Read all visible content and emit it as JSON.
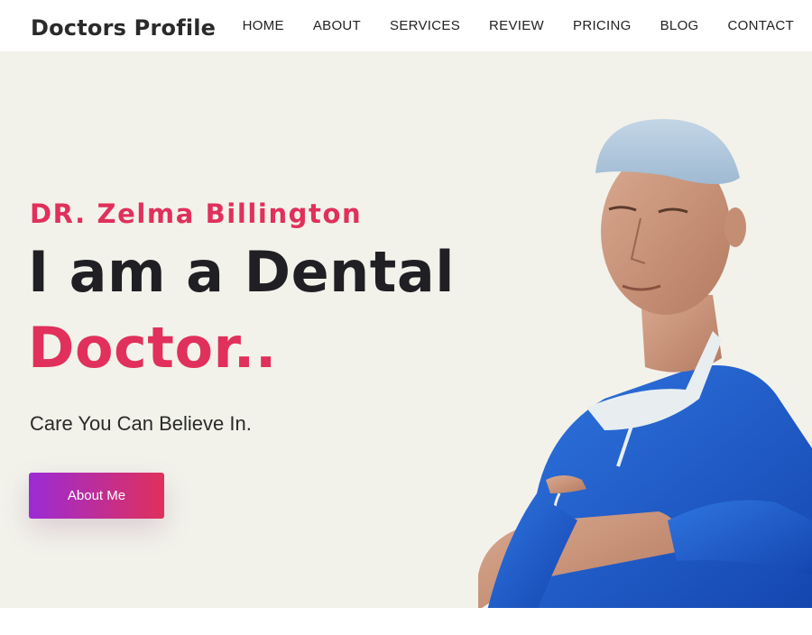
{
  "brand": {
    "logo_text": "Doctors Profile"
  },
  "nav": {
    "items": [
      {
        "label": "HOME"
      },
      {
        "label": "ABOUT"
      },
      {
        "label": "SERVICES"
      },
      {
        "label": "REVIEW"
      },
      {
        "label": "PRICING"
      },
      {
        "label": "BLOG"
      },
      {
        "label": "CONTACT"
      }
    ]
  },
  "hero": {
    "doctor_name": "DR. Zelma Billington",
    "headline_line1": "I am a Dental",
    "headline_line2": "Doctor..",
    "tagline": "Care You Can Believe In.",
    "cta_label": "About Me"
  },
  "colors": {
    "accent": "#e0305b",
    "gradient_start": "#9b2bd6",
    "hero_background": "#f2f2ea",
    "heading_text": "#1f1f24",
    "scrubs_blue": "#1f5fcf"
  }
}
